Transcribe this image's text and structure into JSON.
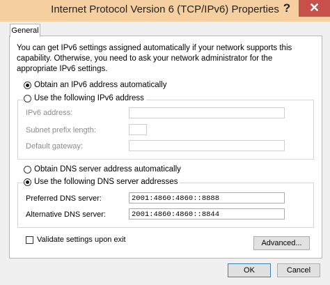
{
  "window": {
    "title": "Internet Protocol Version 6 (TCP/IPv6) Properties",
    "help_label": "?",
    "close_label": "✕"
  },
  "tabs": [
    {
      "label": "General",
      "selected": true
    }
  ],
  "general": {
    "intro": "You can get IPv6 settings assigned automatically if your network supports this capability. Otherwise, you need to ask your network administrator for the appropriate IPv6 settings.",
    "ip": {
      "auto_label": "Obtain an IPv6 address automatically",
      "manual_label": "Use the following IPv6 address",
      "selected": "auto",
      "ipv6_address_label": "IPv6 address:",
      "ipv6_address_value": "",
      "subnet_prefix_label": "Subnet prefix length:",
      "subnet_prefix_value": "",
      "gateway_label": "Default gateway:",
      "gateway_value": ""
    },
    "dns": {
      "auto_label": "Obtain DNS server address automatically",
      "manual_label": "Use the following DNS server addresses",
      "selected": "manual",
      "preferred_label": "Preferred DNS server:",
      "preferred_value": "2001:4860:4860::8888",
      "alternative_label": "Alternative DNS server:",
      "alternative_value": "2001:4860:4860::8844"
    },
    "validate_label": "Validate settings upon exit",
    "validate_checked": false,
    "advanced_label": "Advanced..."
  },
  "buttons": {
    "ok_label": "OK",
    "cancel_label": "Cancel"
  }
}
